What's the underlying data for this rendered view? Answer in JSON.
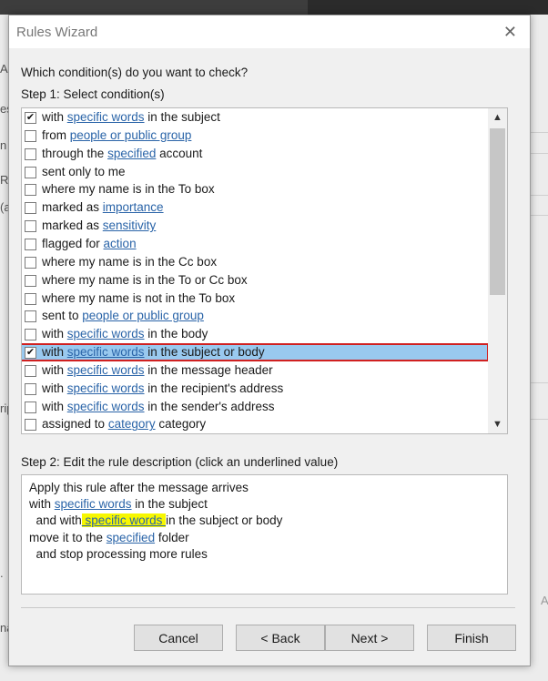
{
  "background": {
    "left_fragments": [
      "A",
      "es",
      "n",
      "Ru",
      "(a",
      "rip",
      ".",
      "na"
    ],
    "right_fragment": "A"
  },
  "dialog": {
    "title": "Rules Wizard",
    "close_icon": "close-icon",
    "question": "Which condition(s) do you want to check?",
    "step1_label": "Step 1: Select condition(s)",
    "step2_label": "Step 2: Edit the rule description (click an underlined value)"
  },
  "conditions": [
    {
      "checked": true,
      "pre": "with ",
      "link": "specific words",
      "post": " in the subject"
    },
    {
      "checked": false,
      "pre": "from ",
      "link": "people or public group",
      "post": ""
    },
    {
      "checked": false,
      "pre": "through the ",
      "link": "specified",
      "post": " account"
    },
    {
      "checked": false,
      "pre": "sent only to me",
      "link": "",
      "post": ""
    },
    {
      "checked": false,
      "pre": "where my name is in the To box",
      "link": "",
      "post": ""
    },
    {
      "checked": false,
      "pre": "marked as ",
      "link": "importance",
      "post": ""
    },
    {
      "checked": false,
      "pre": "marked as ",
      "link": "sensitivity",
      "post": ""
    },
    {
      "checked": false,
      "pre": "flagged for ",
      "link": "action",
      "post": ""
    },
    {
      "checked": false,
      "pre": "where my name is in the Cc box",
      "link": "",
      "post": ""
    },
    {
      "checked": false,
      "pre": "where my name is in the To or Cc box",
      "link": "",
      "post": ""
    },
    {
      "checked": false,
      "pre": "where my name is not in the To box",
      "link": "",
      "post": ""
    },
    {
      "checked": false,
      "pre": "sent to ",
      "link": "people or public group",
      "post": ""
    },
    {
      "checked": false,
      "pre": "with ",
      "link": "specific words",
      "post": " in the body"
    },
    {
      "checked": true,
      "pre": "with ",
      "link": "specific words",
      "post": " in the subject or body",
      "selected": true
    },
    {
      "checked": false,
      "pre": "with ",
      "link": "specific words",
      "post": " in the message header"
    },
    {
      "checked": false,
      "pre": "with ",
      "link": "specific words",
      "post": " in the recipient's address"
    },
    {
      "checked": false,
      "pre": "with ",
      "link": "specific words",
      "post": " in the sender's address"
    },
    {
      "checked": false,
      "pre": "assigned to ",
      "link": "category",
      "post": " category"
    }
  ],
  "description": {
    "line1": "Apply this rule after the message arrives",
    "line2_pre": "with ",
    "line2_link": "specific words",
    "line2_post": " in the subject",
    "line3_pre": "  and with",
    "line3_link": " specific words ",
    "line3_post": "in the subject or body",
    "line4_pre": "move it to the ",
    "line4_link": "specified",
    "line4_post": " folder",
    "line5": "  and stop processing more rules"
  },
  "buttons": {
    "cancel": "Cancel",
    "back": "< Back",
    "next": "Next >",
    "finish": "Finish"
  },
  "colors": {
    "link": "#2a64a8",
    "selection": "#99c9ef",
    "highlight_outline": "#d02020",
    "text_highlight": "#f7f700"
  }
}
